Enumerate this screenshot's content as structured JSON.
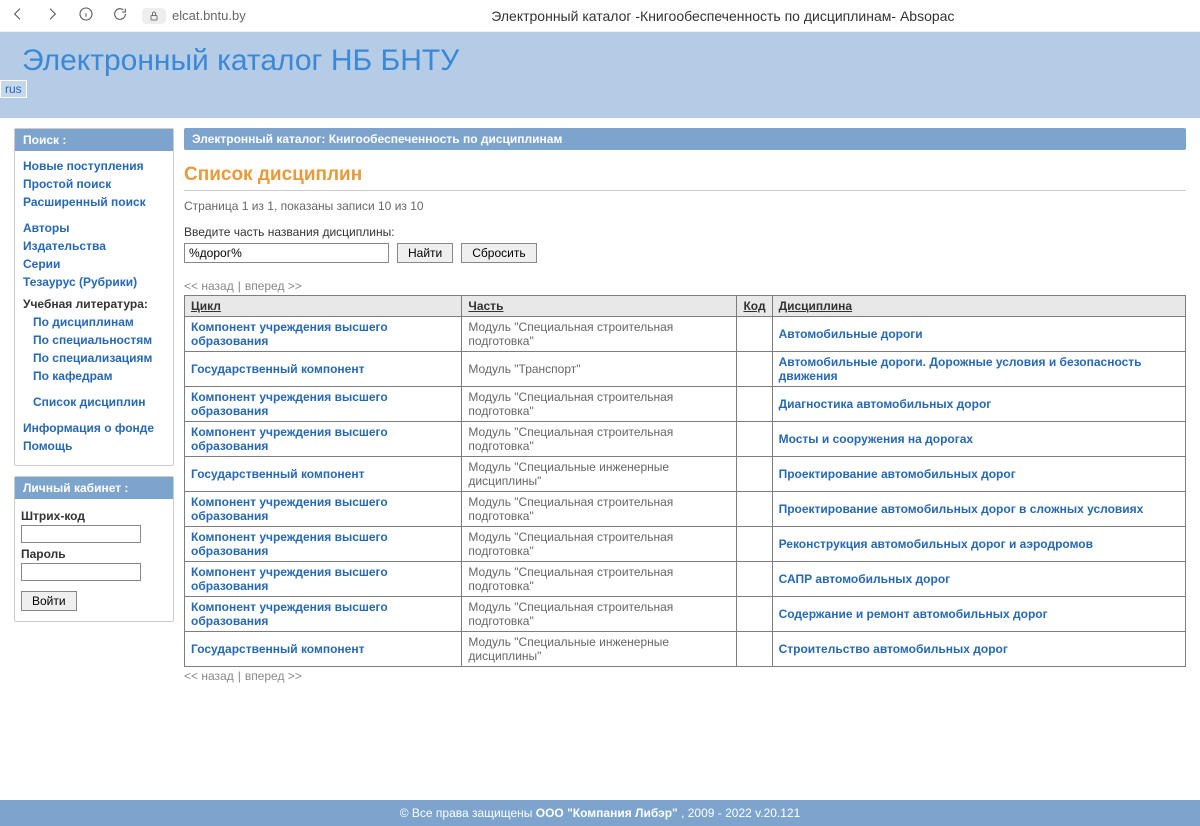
{
  "browser": {
    "url": "elcat.bntu.by",
    "tab_title": "Электронный каталог -Книгообеспеченность по дисциплинам- Absopac"
  },
  "header": {
    "site_title": "Электронный каталог НБ БНТУ",
    "lang": "rus"
  },
  "sidebar": {
    "search_head": "Поиск :",
    "links1": [
      "Новые поступления",
      "Простой поиск",
      "Расширенный поиск"
    ],
    "links2": [
      "Авторы",
      "Издательства",
      "Серии",
      "Тезаурус (Рубрики)"
    ],
    "edu_heading": "Учебная литература:",
    "edu_links": [
      "По дисциплинам",
      "По специальностям",
      "По специализациям",
      "По кафедрам"
    ],
    "edu_link_extra": "Список дисциплин",
    "links3": [
      "Информация о фонде",
      "Помощь"
    ],
    "cabinet_head": "Личный кабинет :",
    "barcode_label": "Штрих-код",
    "password_label": "Пароль",
    "login_btn": "Войти"
  },
  "main": {
    "breadcrumb": "Электронный каталог: Книгообеспеченность по дисциплинам",
    "page_title": "Список дисциплин",
    "pager_info": "Страница 1 из 1, показаны записи 10 из 10",
    "filter_label": "Введите часть названия дисциплины:",
    "filter_value": "%дорог%",
    "find_btn": "Найти",
    "reset_btn": "Сбросить",
    "nav_back": "<< назад",
    "nav_fwd": "вперед >>",
    "columns": {
      "cycle": "Цикл",
      "part": "Часть",
      "code": "Код",
      "disc": "Дисциплина"
    },
    "rows": [
      {
        "cycle": "Компонент учреждения высшего образования",
        "part": "Модуль \"Специальная строительная подготовка\"",
        "code": "",
        "disc": "Автомобильные дороги"
      },
      {
        "cycle": "Государственный компонент",
        "part": "Модуль \"Транспорт\"",
        "code": "",
        "disc": "Автомобильные дороги. Дорожные условия и безопасность движения"
      },
      {
        "cycle": "Компонент учреждения высшего образования",
        "part": "Модуль \"Специальная строительная подготовка\"",
        "code": "",
        "disc": "Диагностика автомобильных дорог"
      },
      {
        "cycle": "Компонент учреждения высшего образования",
        "part": "Модуль \"Специальная строительная подготовка\"",
        "code": "",
        "disc": "Мосты и сооружения на дорогах"
      },
      {
        "cycle": "Государственный компонент",
        "part": "Модуль \"Специальные инженерные дисциплины\"",
        "code": "",
        "disc": "Проектирование автомобильных дорог"
      },
      {
        "cycle": "Компонент учреждения высшего образования",
        "part": "Модуль \"Специальная строительная подготовка\"",
        "code": "",
        "disc": "Проектирование автомобильных дорог в сложных условиях"
      },
      {
        "cycle": "Компонент учреждения высшего образования",
        "part": "Модуль \"Специальная строительная подготовка\"",
        "code": "",
        "disc": "Реконструкция автомобильных дорог и аэродромов"
      },
      {
        "cycle": "Компонент учреждения высшего образования",
        "part": "Модуль \"Специальная строительная подготовка\"",
        "code": "",
        "disc": "САПР автомобильных дорог"
      },
      {
        "cycle": "Компонент учреждения высшего образования",
        "part": "Модуль \"Специальная строительная подготовка\"",
        "code": "",
        "disc": "Содержание и ремонт автомобильных дорог"
      },
      {
        "cycle": "Государственный компонент",
        "part": "Модуль \"Специальные инженерные дисциплины\"",
        "code": "",
        "disc": "Строительство автомобильных дорог"
      }
    ]
  },
  "footer": {
    "rights": "© Все права защищены ",
    "company": "ООО \"Компания Либэр\"",
    "years": " , 2009 - 2022  v.20.121"
  }
}
